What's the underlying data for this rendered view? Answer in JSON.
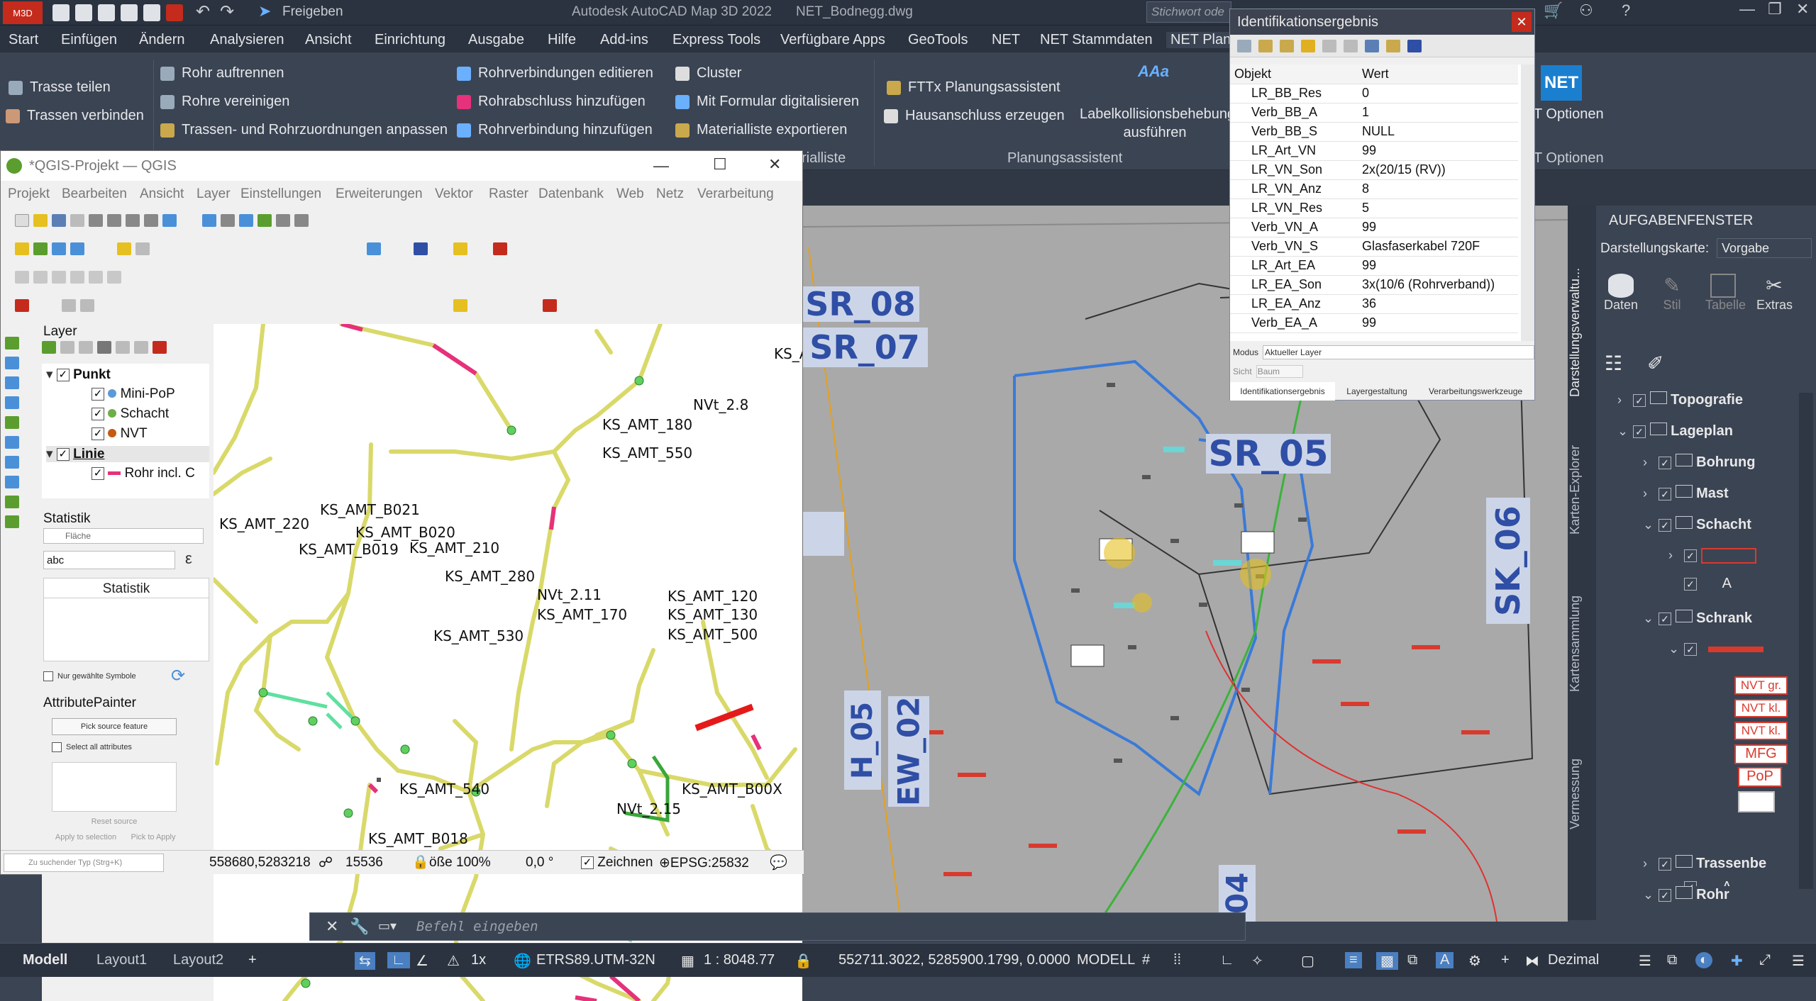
{
  "app": {
    "badge": "M3D",
    "title": "Autodesk AutoCAD Map 3D 2022",
    "document": "NET_Bodnegg.dwg",
    "share": "Freigeben",
    "search_placeholder": "Stichwort ode"
  },
  "menus": [
    "Start",
    "Einfügen",
    "Ändern",
    "Analysieren",
    "Ansicht",
    "Einrichtung",
    "Ausgabe",
    "Hilfe",
    "Add-ins",
    "Express Tools",
    "Verfügbare Apps",
    "GeoTools",
    "NET",
    "NET Stammdaten",
    "NET Plan"
  ],
  "ribbon": {
    "col1": [
      "Trasse teilen",
      "Trassen verbinden"
    ],
    "col2": [
      "Rohr auftrennen",
      "Rohre vereinigen",
      "Trassen- und Rohrzuordnungen anpassen"
    ],
    "col3": [
      "Rohrverbindungen editieren",
      "Rohrabschluss hinzufügen",
      "Rohrverbindung hinzufügen"
    ],
    "col4": [
      "Cluster",
      "Mit Formular digitalisieren",
      "Materialliste exportieren"
    ],
    "col5": [
      "FTTx Planungsassistent",
      "Hausanschluss erzeugen"
    ],
    "label_collision": "Labelkollisionsbehebung ausführen",
    "section_materialliste": "rialliste",
    "section_planung": "Planungsassistent",
    "section_optionen": "T Optionen",
    "optionen": "T Optionen",
    "net_logo": "NET"
  },
  "id_window": {
    "title": "Identifikationsergebnis",
    "col_object": "Objekt",
    "col_value": "Wert",
    "rows": [
      [
        "LR_BB_Res",
        "0"
      ],
      [
        "Verb_BB_A",
        "1"
      ],
      [
        "Verb_BB_S",
        "NULL"
      ],
      [
        "LR_Art_VN",
        "99"
      ],
      [
        "LR_VN_Son",
        "2x(20/15 (RV))"
      ],
      [
        "LR_VN_Anz",
        "8"
      ],
      [
        "LR_VN_Res",
        "5"
      ],
      [
        "Verb_VN_A",
        "99"
      ],
      [
        "Verb_VN_S",
        "Glasfaserkabel 720F"
      ],
      [
        "LR_Art_EA",
        "99"
      ],
      [
        "LR_EA_Son",
        "3x(10/6 (Rohrverband))"
      ],
      [
        "LR_EA_Anz",
        "36"
      ],
      [
        "Verb_EA_A",
        "99"
      ]
    ],
    "mode_label": "Modus",
    "mode_value": "Aktueller Layer",
    "view_label": "Sicht",
    "view_value": "Baum",
    "tabs": [
      "Identifikationsergebnis",
      "Layergestaltung",
      "Verarbeitungswerkzeuge"
    ]
  },
  "qgis": {
    "title": "*QGIS-Projekt — QGIS",
    "menus": [
      "Projekt",
      "Bearbeiten",
      "Ansicht",
      "Layer",
      "Einstellungen",
      "Erweiterungen",
      "Vektor",
      "Raster",
      "Datenbank",
      "Web",
      "Netz",
      "Verarbeitung"
    ],
    "layer_panel_title": "Layer",
    "layers": [
      {
        "name": "Punkt",
        "bold": true
      },
      {
        "name": "Mini-PoP",
        "color": "#5b9bd5"
      },
      {
        "name": "Schacht",
        "color": "#70ad47"
      },
      {
        "name": "NVT",
        "color": "#c55a11"
      },
      {
        "name": "Linie",
        "bold": true
      },
      {
        "name": "Rohr incl. C",
        "color": "#e6317b"
      }
    ],
    "stat_title": "Statistik",
    "stat_field": "Fläche",
    "stat_value": "abc",
    "stat_col": "Statistik",
    "only_selected": "Nur gewählte Symbole",
    "ap_title": "AttributePainter",
    "pick_source": "Pick source feature",
    "select_all": "Select all attributes",
    "reset_source": "Reset source",
    "apply_selection": "Apply to selection",
    "pick_apply": "Pick to Apply",
    "map_labels": [
      "KS_AMT_180",
      "KS_AMT_550",
      "NVt_2.8",
      "KS_A",
      "KS_AMT_220",
      "KS_AMT_B021",
      "KS_AMT_B020",
      "KS_AMT_B019",
      "KS_AMT_210",
      "KS_AMT_280",
      "NVt_2.11",
      "KS_AMT_170",
      "KS_AMT_120",
      "KS_AMT_130",
      "KS_AMT_500",
      "KS_AMT_530",
      "KS_AMT_540",
      "KS_AMT_B00X",
      "NVt_2.15",
      "KS_AMT_B018"
    ],
    "status": {
      "locator": "Zu suchender Typ (Strg+K)",
      "coord": "558680,5283218",
      "scale": "15536",
      "magnifier": "ößе 100%",
      "rotation": "0,0 °",
      "render": "Zeichnen",
      "crs": "EPSG:25832"
    }
  },
  "canvas_labels": [
    "SR_08",
    "SR_07",
    "SR_05",
    "SK_06",
    "H_05",
    "EW_02",
    "04"
  ],
  "taskpane": {
    "title": "AUFGABENFENSTER",
    "display_map_label": "Darstellungskarte:",
    "display_map_value": "Vorgabe",
    "tools": [
      "Daten",
      "Stil",
      "Tabelle",
      "Extras"
    ],
    "side_tabs": [
      "Darstellungsverwaltu...",
      "Karten-Explorer",
      "Kartensammlung",
      "Vermessung"
    ],
    "tree": [
      "Topografie",
      "Lageplan",
      "Bohrung",
      "Mast",
      "Schacht",
      "Schrank",
      "Trassenbe",
      "Rohr"
    ],
    "legend": [
      "NVT gr.",
      "NVT kl.",
      "NVT kl.",
      "MFG",
      "PoP"
    ]
  },
  "command": {
    "placeholder": "Befehl eingeben"
  },
  "statusbar": {
    "tabs": [
      "Modell",
      "Layout1",
      "Layout2"
    ],
    "scale_factor": "1x",
    "crs": "ETRS89.UTM-32N",
    "scale": "1 : 8048.77",
    "coords": "552711.3022, 5285900.1799, 0.0000",
    "mode": "MODELL",
    "units": "Dezimal"
  },
  "colors": {
    "accent": "#2f4ea5",
    "close": "#c42b1c",
    "pipe": "#e6317b",
    "route": "#d9d96a"
  }
}
